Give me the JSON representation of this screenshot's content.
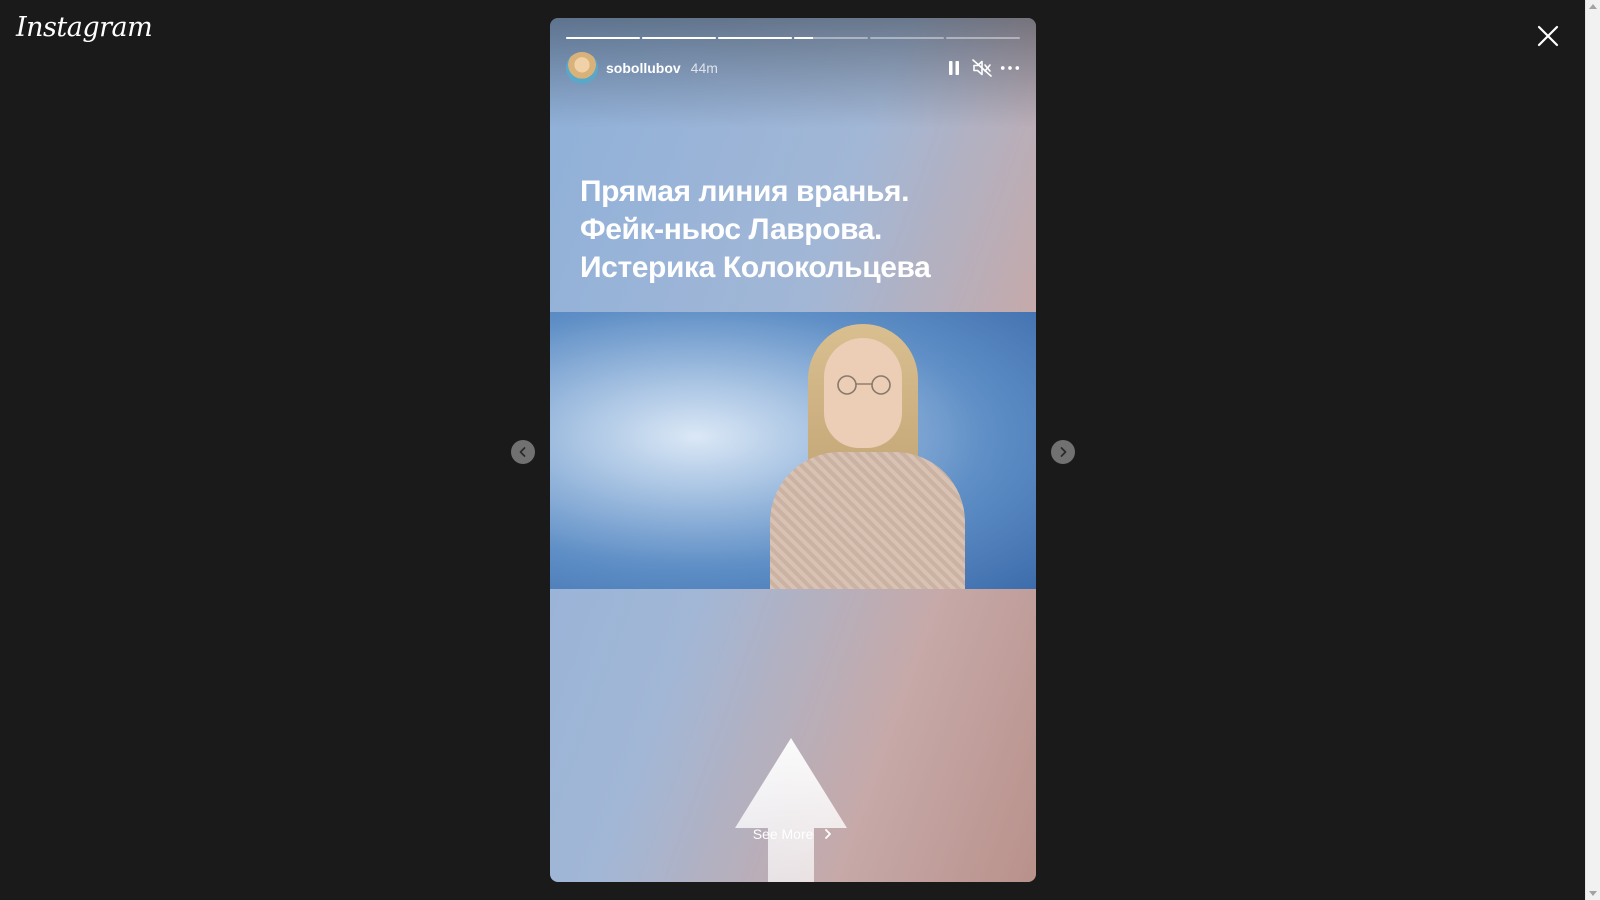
{
  "brand": {
    "logo_text": "Instagram"
  },
  "story": {
    "username": "sobollubov",
    "time_ago": "44m",
    "progress": [
      1,
      1,
      1,
      0.25,
      0,
      0
    ],
    "headline_lines": [
      "Прямая линия вранья.",
      "Фейк-ньюс Лаврова.",
      "Истерика Колокольцева"
    ],
    "see_more_label": "See More"
  },
  "icons": {
    "close": "close-icon",
    "pause": "pause-icon",
    "mute": "muted-speaker-icon",
    "more": "more-options-icon",
    "prev": "chevron-left-icon",
    "next": "chevron-right-icon",
    "see_more": "chevron-right-icon"
  },
  "colors": {
    "page_background": "#1a1a1a",
    "text": "#ffffff",
    "progress_inactive": "rgba(255,255,255,0.4)"
  }
}
